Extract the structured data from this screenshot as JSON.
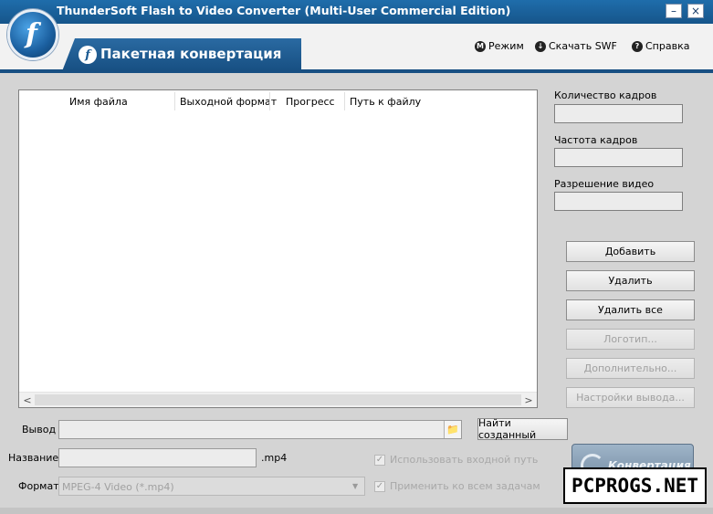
{
  "window": {
    "title": "ThunderSoft Flash to Video Converter (Multi-User Commercial Edition)",
    "minimize": "–",
    "close": "×"
  },
  "header": {
    "logo_letter": "f",
    "tab_icon": "f",
    "tab_label": "Пакетная конвертация",
    "links": [
      {
        "icon": "M",
        "icon_name": "mode-icon",
        "label": "Режим"
      },
      {
        "icon": "↓",
        "icon_name": "download-icon",
        "label": "Скачать SWF"
      },
      {
        "icon": "?",
        "icon_name": "help-icon",
        "label": "Справка"
      }
    ]
  },
  "file_list": {
    "columns": [
      "Имя файла",
      "Выходной формат",
      "Прогресс",
      "Путь к файлу"
    ],
    "scroll_left": "<",
    "scroll_right": ">"
  },
  "side": {
    "frame_count_label": "Количество кадров",
    "frame_count_value": "",
    "frame_rate_label": "Частота кадров",
    "frame_rate_value": "",
    "resolution_label": "Разрешение видео",
    "resolution_value": "",
    "buttons": [
      {
        "label": "Добавить",
        "enabled": true
      },
      {
        "label": "Удалить",
        "enabled": true
      },
      {
        "label": "Удалить все",
        "enabled": true
      },
      {
        "label": "Логотип...",
        "enabled": false
      },
      {
        "label": "Дополнительно...",
        "enabled": false
      },
      {
        "label": "Настройки вывода...",
        "enabled": false
      }
    ]
  },
  "form": {
    "output_label": "Вывод",
    "output_value": "",
    "find_button": "Найти созданный",
    "name_label": "Название",
    "name_value": "",
    "name_ext": ".mp4",
    "format_label": "Формат",
    "format_value": "MPEG-4 Video (*.mp4)",
    "use_input_path": "Использовать входной путь",
    "apply_all": "Применить ко всем задачам",
    "check_mark": "✓"
  },
  "convert": {
    "label": "Конвертация"
  },
  "watermark": "PCPROGS.NET",
  "colors": {
    "accent": "#174f82",
    "titlebar": "#1f6dab"
  }
}
